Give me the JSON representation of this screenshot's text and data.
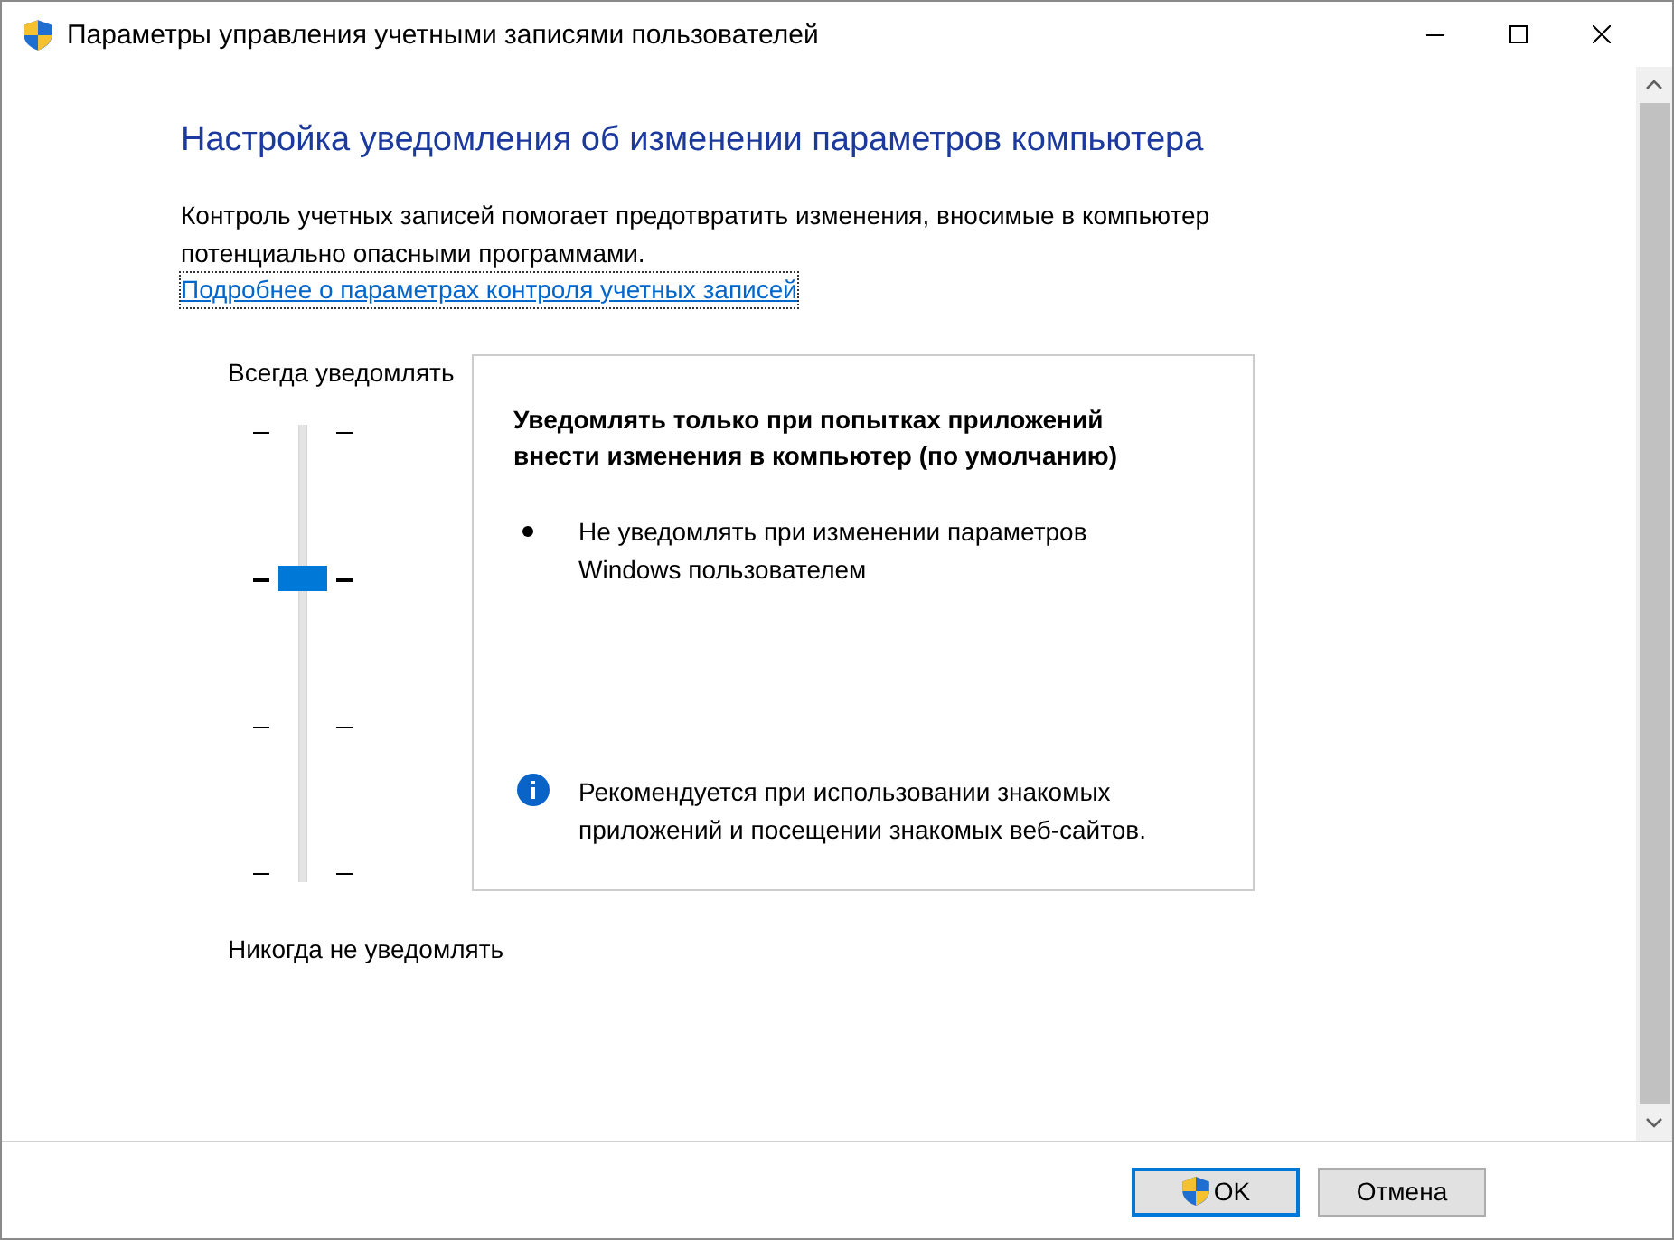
{
  "window": {
    "title": "Параметры управления учетными записями пользователей"
  },
  "heading": "Настройка уведомления об изменении параметров компьютера",
  "description": "Контроль учетных записей помогает предотвратить изменения, вносимые в компьютер потенциально опасными программами.",
  "link": "Подробнее о параметрах контроля учетных записей",
  "slider": {
    "top_label": "Всегда уведомлять",
    "bottom_label": "Никогда не уведомлять",
    "level": 0.667
  },
  "details": {
    "title": "Уведомлять только при попытках приложений внести изменения в компьютер (по умолчанию)",
    "bullets": [
      "Не уведомлять при изменении параметров Windows пользователем"
    ],
    "recommendation": "Рекомендуется при использовании знакомых приложений и посещении знакомых веб-сайтов."
  },
  "buttons": [
    {
      "label": "OK",
      "kind": "shield",
      "default": true
    },
    {
      "label": "Отмена",
      "kind": "plain",
      "default": false
    }
  ]
}
